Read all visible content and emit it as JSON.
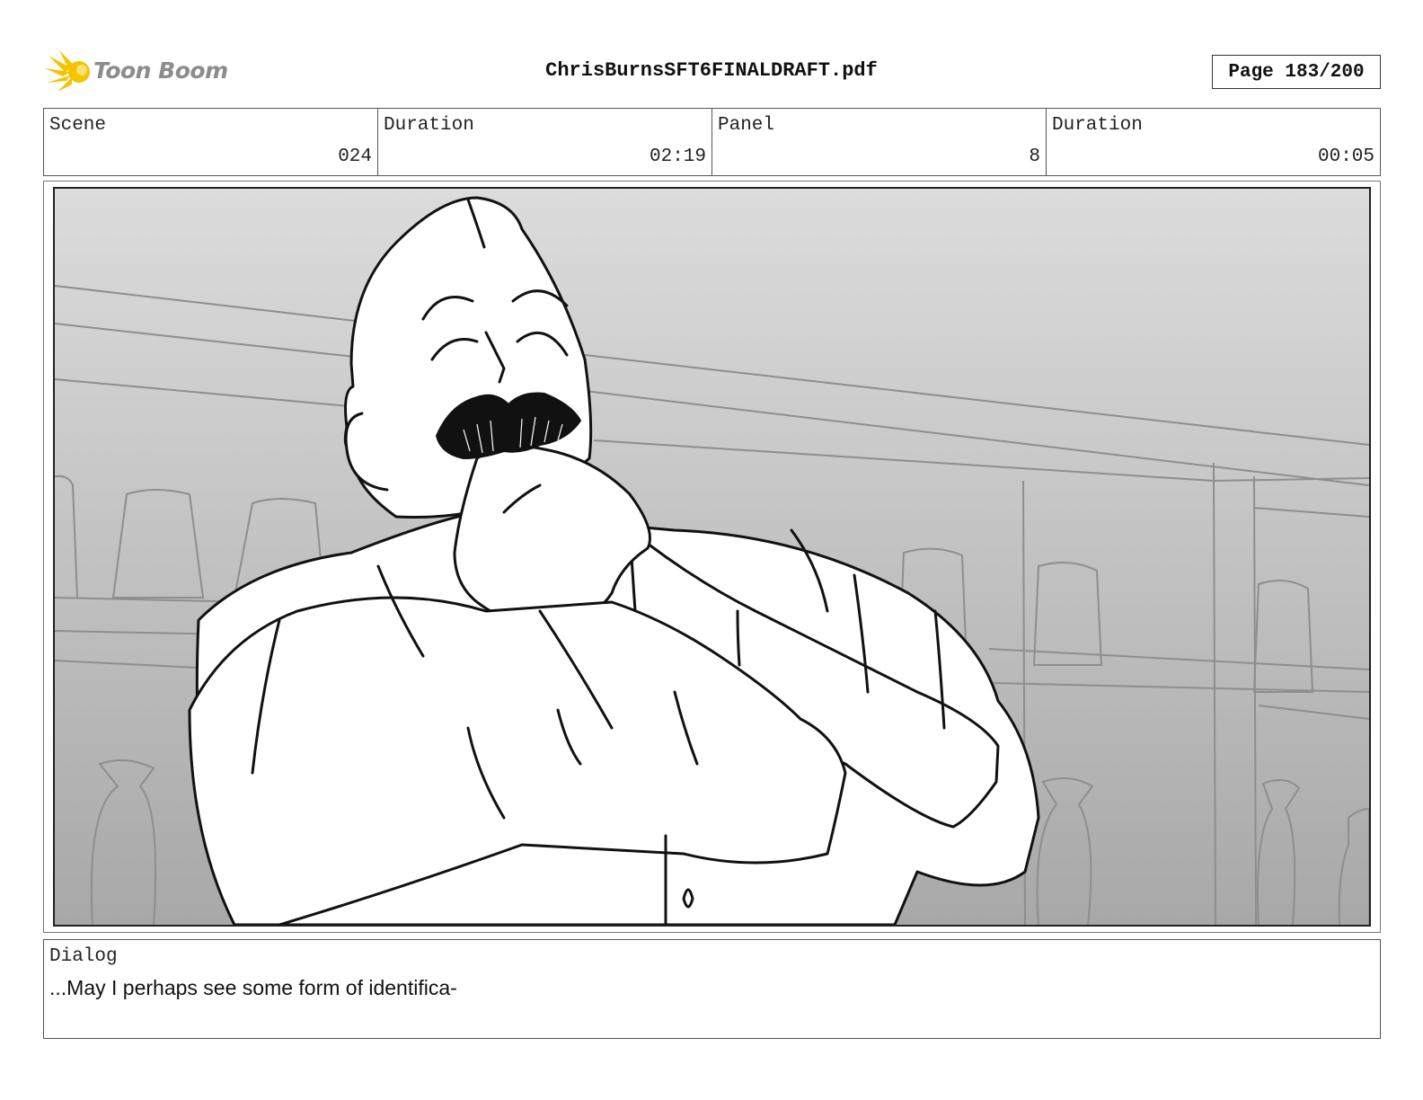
{
  "header": {
    "logo_text": "Toon Boom",
    "logo_icon": "sunburst-logo-icon",
    "document_title": "ChrisBurnsSFT6FINALDRAFT.pdf",
    "page_label": "Page 183/200"
  },
  "info": {
    "scene_label": "Scene",
    "scene_value": "024",
    "scene_duration_label": "Duration",
    "scene_duration_value": "02:19",
    "panel_label": "Panel",
    "panel_value": "8",
    "panel_duration_label": "Duration",
    "panel_duration_value": "00:05"
  },
  "dialog": {
    "label": "Dialog",
    "text": "...May I perhaps see some form of identifica-"
  },
  "colors": {
    "logo_yellow": "#f5c400",
    "logo_text_grey": "#8c8c8c",
    "background_gradient_top": "#dcdcdc",
    "background_gradient_bottom": "#a8a8a8",
    "line_art": "#111111"
  }
}
